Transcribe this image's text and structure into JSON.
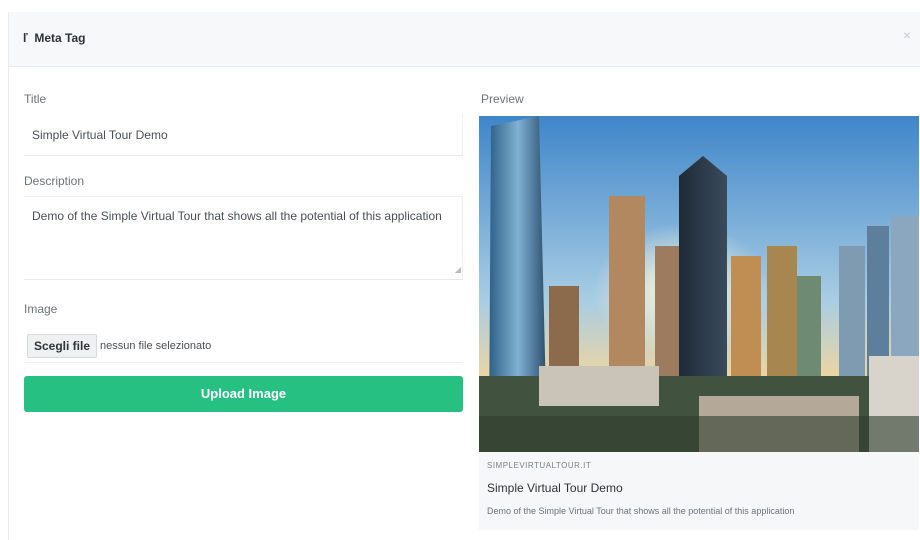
{
  "modal": {
    "title": "Meta Tag",
    "close_symbol": "×"
  },
  "form": {
    "title_label": "Title",
    "title_value": "Simple Virtual Tour Demo",
    "description_label": "Description",
    "description_value": "Demo of the Simple Virtual Tour that shows all the potential of this application",
    "image_label": "Image",
    "file_button_label": "Scegli file",
    "file_status": "nessun file selezionato",
    "upload_button_label": "Upload Image"
  },
  "preview": {
    "label": "Preview",
    "site": "SIMPLEVIRTUALTOUR.IT",
    "title": "Simple Virtual Tour Demo",
    "description": "Demo of the Simple Virtual Tour that shows all the potential of this application"
  },
  "colors": {
    "accent_green": "#26c083",
    "header_bg": "#f6f8fa",
    "card_bg": "#f6f7f8"
  },
  "icons": {
    "header": "tag-icon",
    "close": "close-icon"
  }
}
